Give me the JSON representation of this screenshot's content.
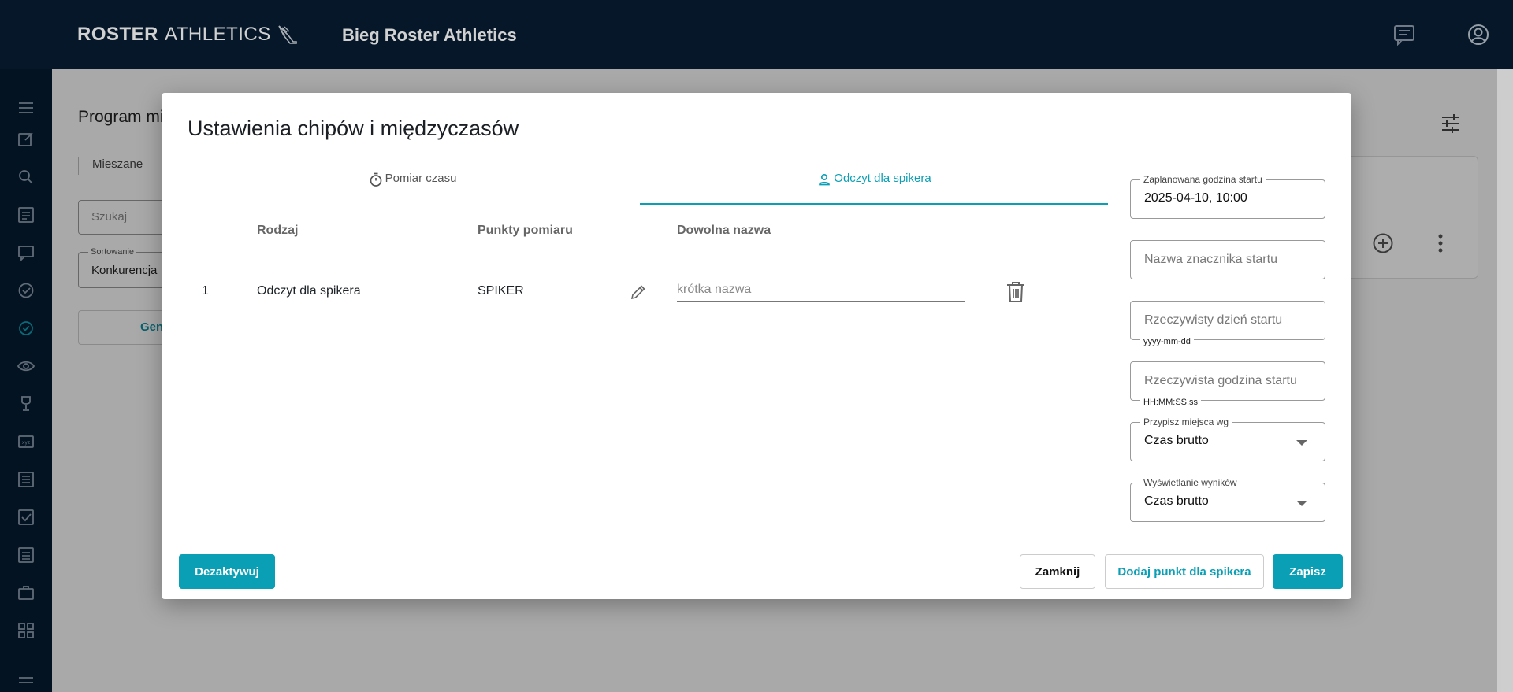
{
  "header": {
    "logo_bold": "ROSTER",
    "logo_light": "ATHLETICS",
    "app_title": "Bieg Roster Athletics"
  },
  "background": {
    "page_title": "Program mi",
    "tab_label": "Mieszane",
    "search_placeholder": "Szukaj",
    "sort_label": "Sortowanie",
    "sort_value": "Konkurencja",
    "generate_button": "Gen"
  },
  "modal": {
    "title": "Ustawienia chipów i międzyczasów",
    "tabs": [
      {
        "label": "Pomiar czasu",
        "icon": "stopwatch-icon",
        "active": false
      },
      {
        "label": "Odczyt dla spikera",
        "icon": "person-icon",
        "active": true
      }
    ],
    "table": {
      "headers": {
        "type": "Rodzaj",
        "points": "Punkty pomiaru",
        "name": "Dowolna nazwa"
      },
      "rows": [
        {
          "index": "1",
          "type": "Odczyt dla spikera",
          "points": "SPIKER",
          "name_placeholder": "krótka nazwa",
          "name_value": ""
        }
      ]
    },
    "fields": {
      "planned_start": {
        "label": "Zaplanowana godzina startu",
        "value": "2025-04-10, 10:00"
      },
      "start_tag_name": {
        "placeholder": "Nazwa znacznika startu"
      },
      "actual_start_day": {
        "placeholder": "Rzeczywisty dzień startu",
        "hint": "yyyy-mm-dd"
      },
      "actual_start_time": {
        "placeholder": "Rzeczywista godzina startu",
        "hint": "HH:MM:SS.ss"
      },
      "assign_places": {
        "label": "Przypisz miejsca wg",
        "value": "Czas brutto"
      },
      "results_display": {
        "label": "Wyświetlanie wyników",
        "value": "Czas brutto"
      }
    },
    "buttons": {
      "deactivate": "Dezaktywuj",
      "close": "Zamknij",
      "add_speaker_point": "Dodaj punkt dla spikera",
      "save": "Zapisz"
    }
  },
  "colors": {
    "topbar": "#071d33",
    "accent": "#0a9fb5"
  }
}
